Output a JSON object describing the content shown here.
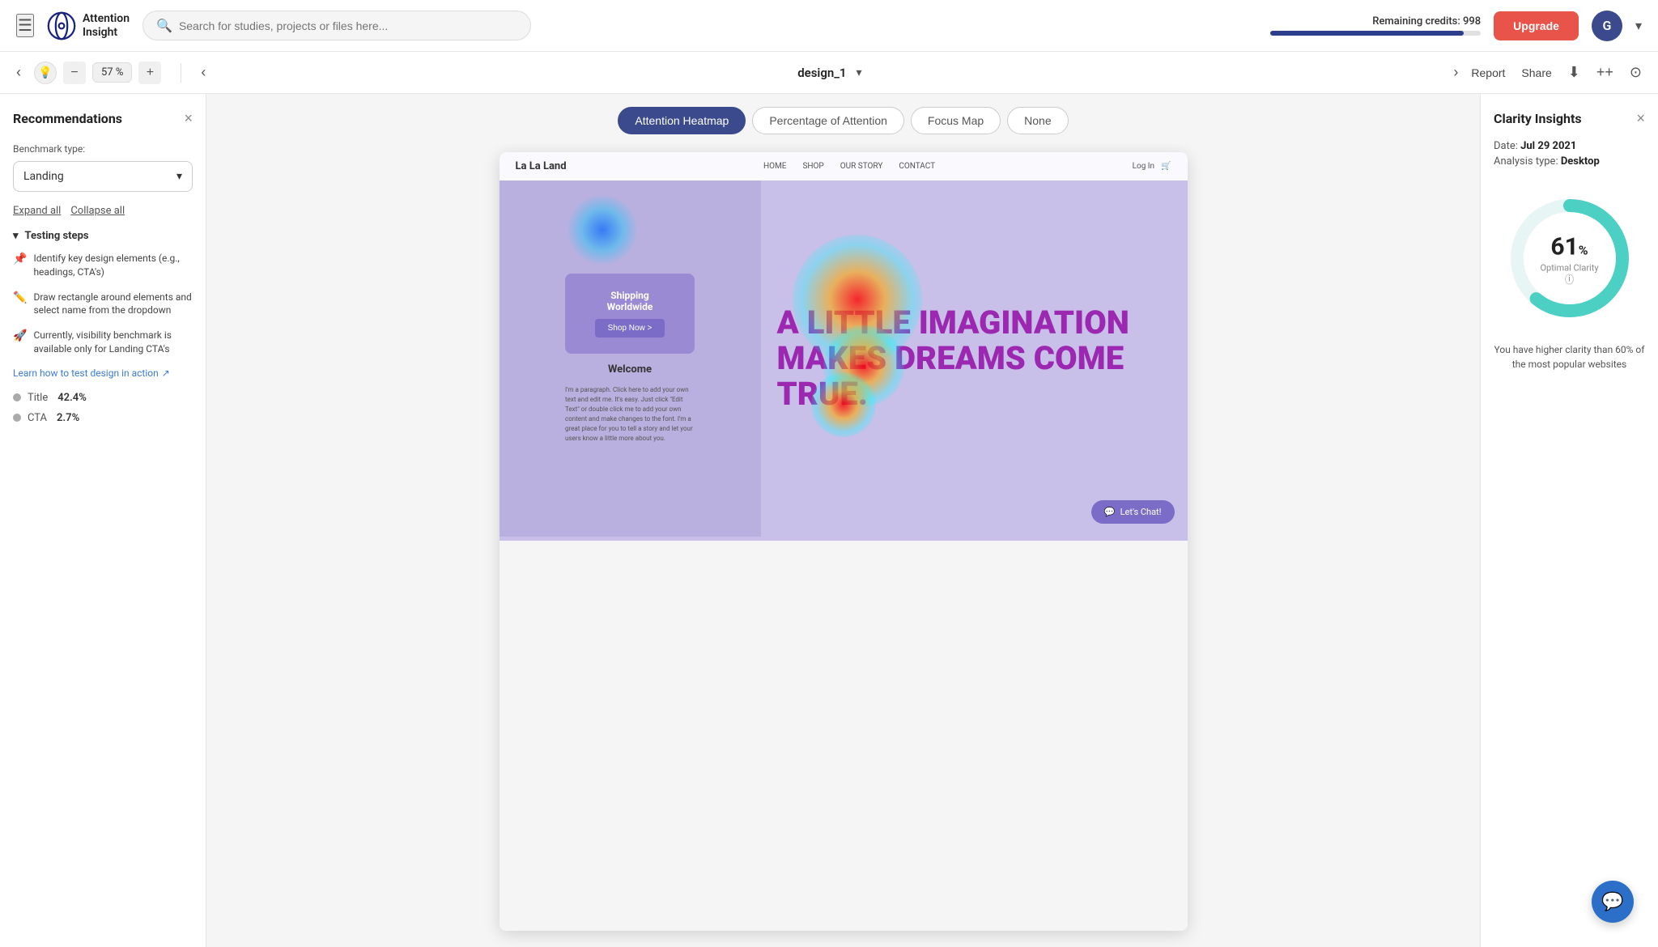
{
  "topnav": {
    "logo_text": "Attention\nInsight",
    "search_placeholder": "Search for studies, projects or files here...",
    "credits_label": "Remaining credits: 998",
    "upgrade_label": "Upgrade",
    "avatar_letter": "G"
  },
  "toolbar": {
    "prev_label": "‹",
    "next_label": "›",
    "zoom_percent": "57 %",
    "zoom_minus": "−",
    "zoom_plus": "+",
    "filename": "design_1",
    "report_label": "Report",
    "share_label": "Share",
    "download_label": "↓",
    "expand_label": "++",
    "settings_label": "⊙"
  },
  "left_panel": {
    "title": "Recommendations",
    "close_label": "×",
    "benchmark_label": "Benchmark type:",
    "benchmark_value": "Landing",
    "expand_all": "Expand all",
    "collapse_all": "Collapse all",
    "testing_steps_label": "Testing steps",
    "steps": [
      {
        "icon": "📌",
        "text": "Identify key design elements (e.g., headings, CTA's)"
      },
      {
        "icon": "✏️",
        "text": "Draw rectangle around elements and select name from the dropdown"
      },
      {
        "icon": "🚀",
        "text": "Currently, visibility benchmark is available only for Landing CTA's"
      }
    ],
    "learn_link": "Learn how to test design in action",
    "metrics": [
      {
        "name": "Title",
        "value": "42.4%"
      },
      {
        "name": "CTA",
        "value": "2.7%"
      }
    ]
  },
  "view_tabs": [
    {
      "label": "Attention Heatmap",
      "active": true
    },
    {
      "label": "Percentage of Attention",
      "active": false
    },
    {
      "label": "Focus Map",
      "active": false
    },
    {
      "label": "None",
      "active": false
    }
  ],
  "design": {
    "mockup_logo": "La La Land",
    "mockup_nav_items": [
      "HOME",
      "SHOP",
      "OUR STORY",
      "CONTACT"
    ],
    "mockup_nav_right": [
      "Log In",
      "🛒"
    ],
    "shipping_text": "Shipping Worldwide",
    "shop_now_btn": "Shop Now >",
    "welcome_text": "Welcome",
    "paragraph_text": "I'm a paragraph. Click here to add your own text and edit me. It's easy. Just click \"Edit Text\" or double click me to add your own content and make changes to the font. I'm a great place for you to tell a story and let your users know a little more about you.",
    "headline": "A LITTLE IMAGINATION MAKES DREAMS COME TRUE.",
    "chat_btn": "Let's Chat!"
  },
  "right_panel": {
    "title": "Clarity Insights",
    "close_label": "×",
    "date_label": "Date:",
    "date_value": "Jul 29 2021",
    "analysis_label": "Analysis type:",
    "analysis_value": "Desktop",
    "donut_percent": "61",
    "donut_label": "Optimal Clarity",
    "clarity_description": "You have higher clarity than 60% of the most popular websites"
  }
}
